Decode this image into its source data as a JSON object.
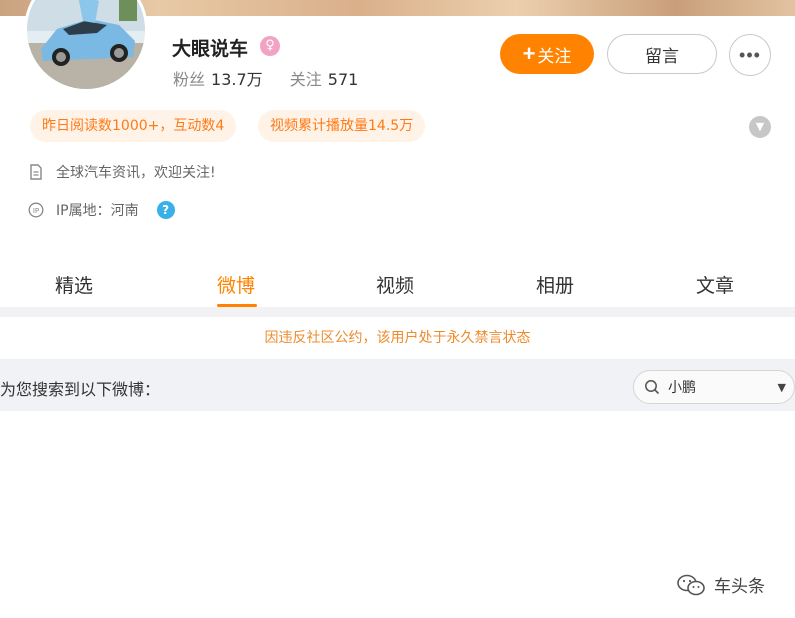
{
  "profile": {
    "name": "大眼说车",
    "fans_label": "粉丝",
    "fans_count": "13.7万",
    "following_label": "关注",
    "following_count": "571"
  },
  "actions": {
    "follow_label": "关注",
    "message_label": "留言",
    "more_label": "•••"
  },
  "badges": [
    {
      "text": "昨日阅读数1000+，互动数4"
    },
    {
      "text": "视频累计播放量14.5万"
    }
  ],
  "info": {
    "bio": "全球汽车资讯，欢迎关注!",
    "ip_location": "IP属地：河南"
  },
  "tabs": [
    {
      "label": "精选",
      "active": false
    },
    {
      "label": "微博",
      "active": true
    },
    {
      "label": "视频",
      "active": false
    },
    {
      "label": "相册",
      "active": false
    },
    {
      "label": "文章",
      "active": false
    }
  ],
  "notice": "因违反社区公约，该用户处于永久禁言状态",
  "search": {
    "result_text": "为您搜索到以下微博：",
    "query": "小鹏"
  },
  "watermark": "车头条",
  "colors": {
    "accent": "#ff8200",
    "badge_bg": "#fff3e8",
    "notice": "#ef8b2d"
  }
}
